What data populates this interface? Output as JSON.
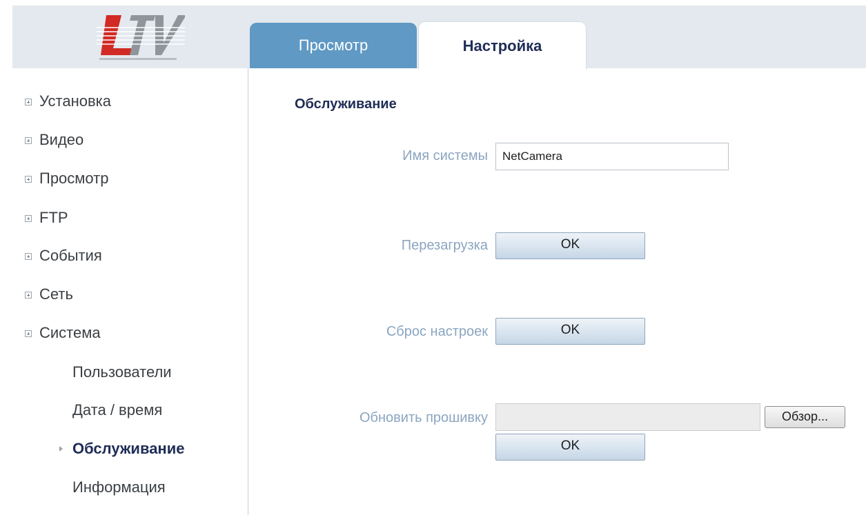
{
  "brand": {
    "logo_text": "LTV",
    "colors": {
      "red": "#d22a24",
      "grey": "#8f959a"
    }
  },
  "tabs": [
    {
      "label": "Просмотр",
      "active": false
    },
    {
      "label": "Настройка",
      "active": true
    }
  ],
  "sidebar": {
    "items": [
      {
        "label": "Установка",
        "icon": "expand-plus-icon"
      },
      {
        "label": "Видео",
        "icon": "expand-plus-icon"
      },
      {
        "label": "Просмотр",
        "icon": "expand-plus-icon"
      },
      {
        "label": "FTP",
        "icon": "expand-plus-icon"
      },
      {
        "label": "События",
        "icon": "expand-plus-icon"
      },
      {
        "label": "Сеть",
        "icon": "expand-plus-icon"
      },
      {
        "label": "Система",
        "icon": "expand-plus-icon"
      }
    ],
    "subitems": [
      {
        "label": "Пользователи",
        "active": false
      },
      {
        "label": "Дата / время",
        "active": false
      },
      {
        "label": "Обслуживание",
        "active": true
      },
      {
        "label": "Информация",
        "active": false
      }
    ]
  },
  "main": {
    "title": "Обслуживание",
    "system_name": {
      "label": "Имя системы",
      "value": "NetCamera"
    },
    "reboot": {
      "label": "Перезагрузка",
      "button": "OK"
    },
    "reset": {
      "label": "Сброс настроек",
      "button": "OK"
    },
    "firmware": {
      "label": "Обновить прошивку",
      "browse": "Обзор...",
      "button": "OK"
    }
  },
  "colors": {
    "header_bg": "#e3e9ee",
    "tab_inactive": "#5f99c4",
    "title": "#1f2d56",
    "label": "#8aa5c0"
  }
}
